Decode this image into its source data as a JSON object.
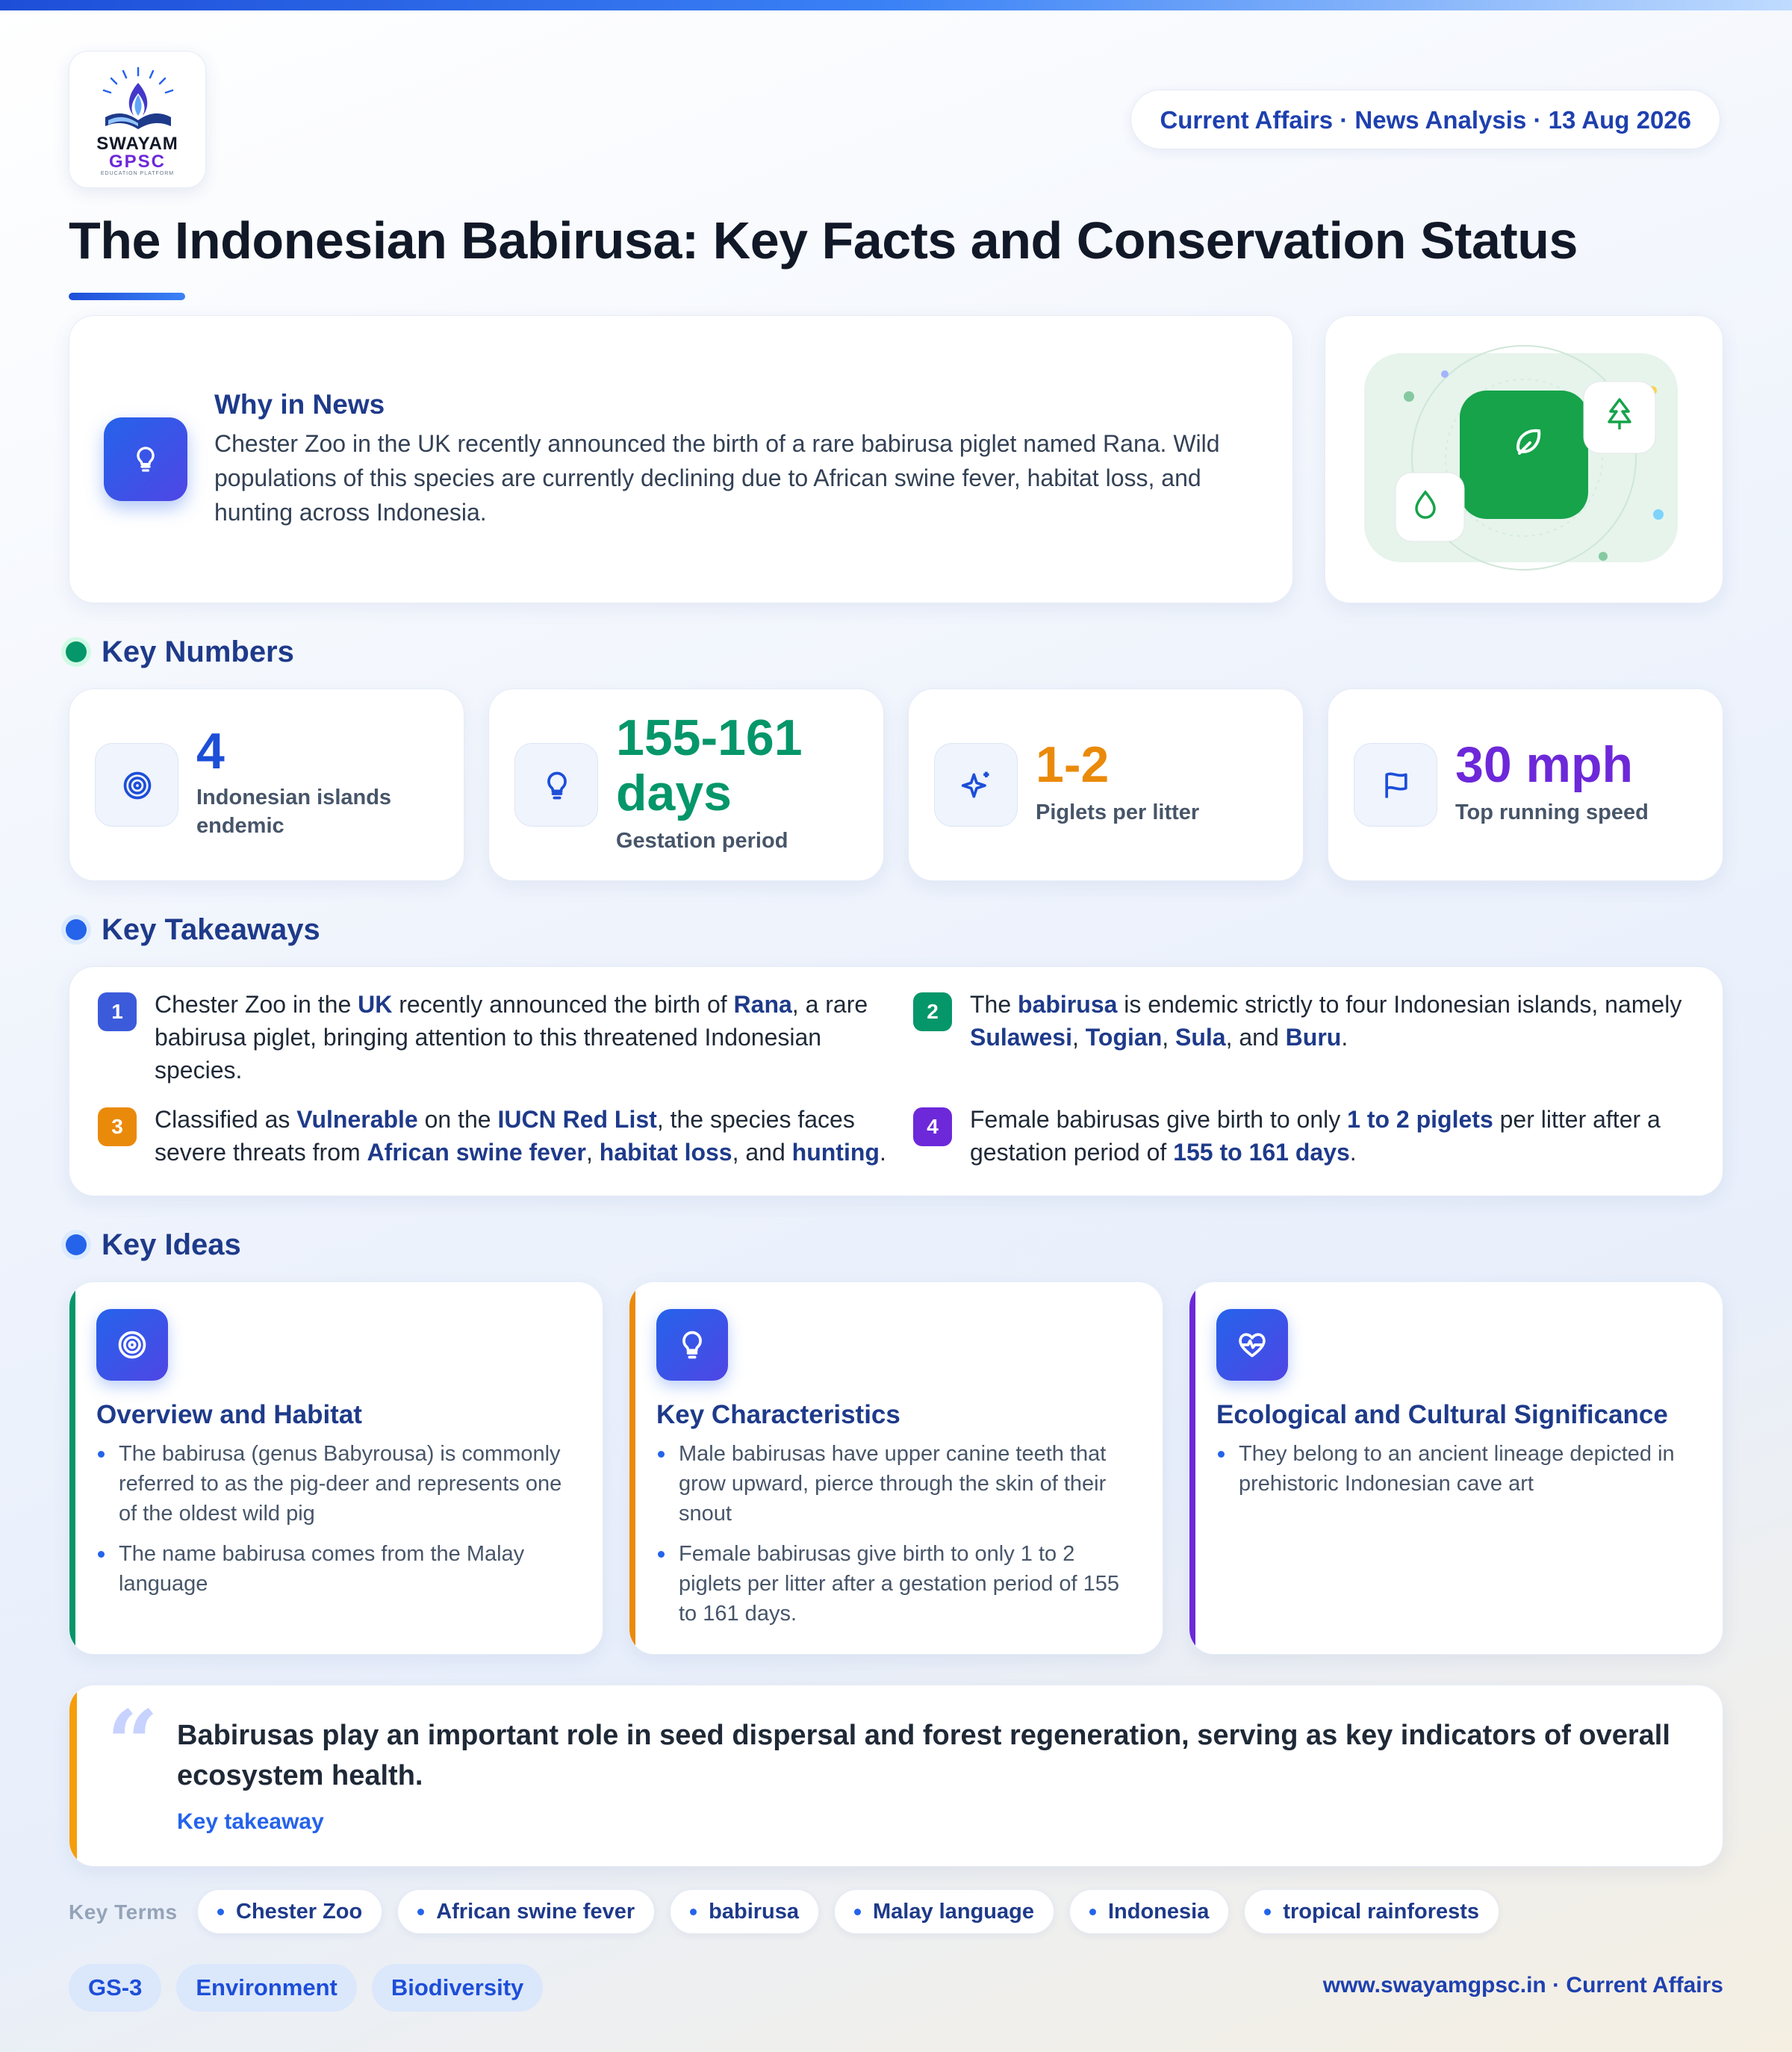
{
  "brand": {
    "name": "SWAYAM",
    "sub": "GPSC",
    "tagline": "EDUCATION PLATFORM"
  },
  "header": {
    "date_pill": "Current Affairs · News Analysis · 13 Aug 2026"
  },
  "title": "The Indonesian Babirusa: Key Facts and Conservation Status",
  "why_in_news": {
    "heading": "Why in News",
    "text": "Chester Zoo in the UK recently announced the birth of a rare babirusa piglet named Rana. Wild populations of this species are currently declining due to African swine fever, habitat loss, and hunting across Indonesia."
  },
  "sections": {
    "numbers": "Key Numbers",
    "takeaways": "Key Takeaways",
    "ideas": "Key Ideas"
  },
  "key_numbers": [
    {
      "value": "4",
      "label": "Indonesian islands endemic",
      "color": "#1d4ed8",
      "icon": "target-icon"
    },
    {
      "value": "155-161 days",
      "label": "Gestation period",
      "color": "#059669",
      "icon": "lightbulb-icon"
    },
    {
      "value": "1-2",
      "label": "Piglets per litter",
      "color": "#ea8a0a",
      "icon": "sparkle-icon"
    },
    {
      "value": "30 mph",
      "label": "Top running speed",
      "color": "#6d28d9",
      "icon": "flag-icon"
    }
  ],
  "takeaways": [
    {
      "num": "1",
      "color": "#3b5bdb"
    },
    {
      "num": "2",
      "color": "#059669"
    },
    {
      "num": "3",
      "color": "#ea8a0a"
    },
    {
      "num": "4",
      "color": "#6d28d9"
    }
  ],
  "takeaway_text": {
    "t1": {
      "a": "Chester Zoo in the ",
      "b": "UK",
      "c": " recently announced the birth of ",
      "d": "Rana",
      "e": ", a rare babirusa piglet, bringing attention to this threatened Indonesian species."
    },
    "t2": {
      "a": "The ",
      "b": "babirusa",
      "c": " is endemic strictly to four Indonesian islands, namely ",
      "d": "Sulawesi",
      "e": ", ",
      "f": "Togian",
      "g": ", ",
      "h": "Sula",
      "i": ", and ",
      "j": "Buru",
      "k": "."
    },
    "t3": {
      "a": "Classified as ",
      "b": "Vulnerable",
      "c": " on the ",
      "d": "IUCN Red List",
      "e": ", the species faces severe threats from ",
      "f": "African swine fever",
      "g": ", ",
      "h": "habitat loss",
      "i": ", and ",
      "j": "hunting",
      "k": "."
    },
    "t4": {
      "a": "Female babirusas give birth to only ",
      "b": "1 to 2 piglets",
      "c": " per litter after a gestation period of ",
      "d": "155 to 161 days",
      "e": "."
    }
  },
  "ideas": [
    {
      "title": "Overview and Habitat",
      "color": "#059669",
      "icon": "target-icon",
      "points": [
        "The babirusa (genus Babyrousa) is commonly referred to as the pig-deer and represents one of the oldest wild pig",
        "The name babirusa comes from the Malay language"
      ]
    },
    {
      "title": "Key Characteristics",
      "color": "#ea8a0a",
      "icon": "lightbulb-icon",
      "points": [
        "Male babirusas have upper canine teeth that grow upward, pierce through the skin of their snout",
        "Female babirusas give birth to only 1 to 2 piglets per litter after a gestation period of 155 to 161 days."
      ]
    },
    {
      "title": "Ecological and Cultural Significance",
      "color": "#6d28d9",
      "icon": "heart-pulse-icon",
      "points": [
        "They belong to an ancient lineage depicted in prehistoric Indonesian cave art"
      ]
    }
  ],
  "quote": {
    "text": "Babirusas play an important role in seed dispersal and forest regeneration, serving as key indicators of overall ecosystem health.",
    "label": "Key takeaway"
  },
  "key_terms": {
    "label": "Key Terms",
    "items": [
      "Chester Zoo",
      "African swine fever",
      "babirusa",
      "Malay language",
      "Indonesia",
      "tropical rainforests"
    ]
  },
  "tags": [
    "GS-3",
    "Environment",
    "Biodiversity"
  ],
  "footer": "www.swayamgpsc.in · Current Affairs"
}
